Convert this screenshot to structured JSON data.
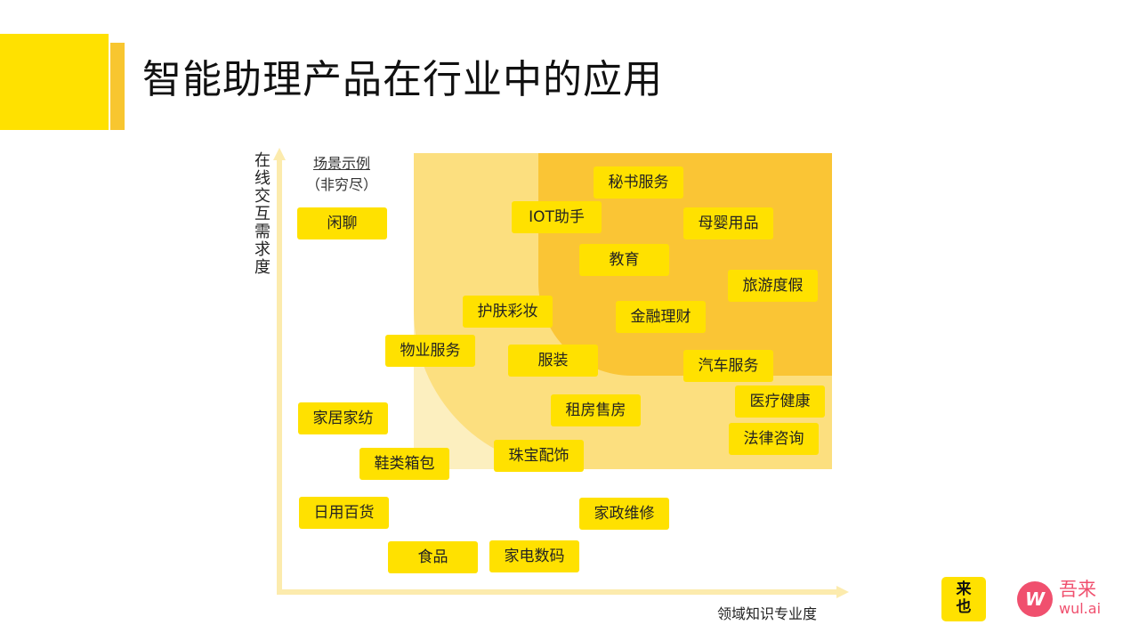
{
  "title": "智能助理产品在行业中的应用",
  "diagram": {
    "y_axis_label": "在线交互需求度",
    "x_axis_label": "领域知识专业度",
    "examples_heading": "场景示例",
    "examples_subheading": "（非穷尽）",
    "tags": {
      "xianliao": "闲聊",
      "mishu": "秘书服务",
      "iot": "IOT助手",
      "muying": "母婴用品",
      "jiaoyu": "教育",
      "lvyou": "旅游度假",
      "hufu": "护肤彩妆",
      "jinrong": "金融理财",
      "wuye": "物业服务",
      "fuzhuang": "服装",
      "qiche": "汽车服务",
      "yiliao": "医疗健康",
      "jiaju": "家居家纺",
      "zufang": "租房售房",
      "falv": "法律咨询",
      "xielei": "鞋类箱包",
      "zhubao": "珠宝配饰",
      "riyong": "日用百货",
      "jiazheng": "家政维修",
      "shipin": "食品",
      "jiadian": "家电数码"
    }
  },
  "logos": {
    "laiye_line1": "来",
    "laiye_line2": "也",
    "wulai_mark": "W",
    "wulai_cn": "吾来",
    "wulai_en": "wul.ai"
  },
  "colors": {
    "brand_yellow": "#ffe100",
    "gold": "#f8c630",
    "zone_light": "#fcefbf",
    "zone_mid": "#fcdf7f",
    "zone_dark": "#fac535",
    "axis": "#fcebad",
    "wulai_pink": "#f0506e"
  }
}
